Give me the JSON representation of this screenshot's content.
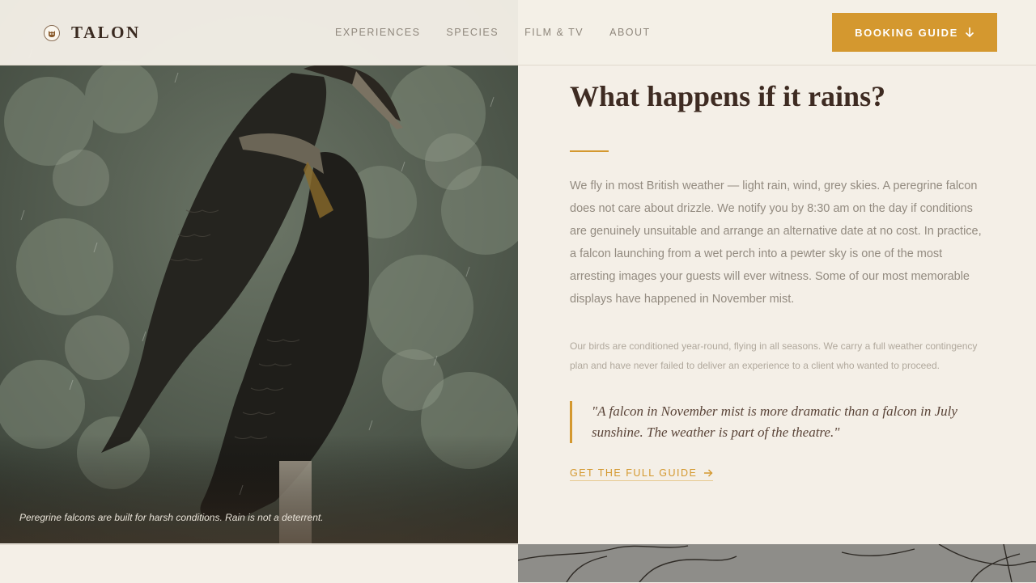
{
  "header": {
    "brand": "TALON",
    "nav": [
      "EXPERIENCES",
      "SPECIES",
      "FILM & TV",
      "ABOUT"
    ],
    "cta_label": "BOOKING GUIDE",
    "accent": "#d4982f"
  },
  "photo": {
    "caption": "Peregrine falcons are built for harsh conditions. Rain is not a deterrent."
  },
  "main": {
    "heading": "What happens if it rains?",
    "body": "We fly in most British weather — light rain, wind, grey skies. A peregrine falcon does not care about drizzle. We notify you by 8:30 am on the day if conditions are genuinely unsuitable and arrange an alternative date at no cost. In practice, a falcon launching from a wet perch into a pewter sky is one of the most arresting images your guests will ever witness. Some of our most memorable displays have happened in November mist.",
    "note": "Our birds are conditioned year-round, flying in all seasons. We carry a full weather contingency plan and have never failed to deliver an experience to a client who wanted to proceed.",
    "quote": "\"A falcon in November mist is more dramatic than a falcon in July sunshine. The weather is part of the theatre.\"",
    "link_label": "GET THE FULL GUIDE"
  },
  "icons": {
    "logo": "owl-icon",
    "cta": "arrow-down-icon",
    "link": "arrow-right-icon"
  }
}
